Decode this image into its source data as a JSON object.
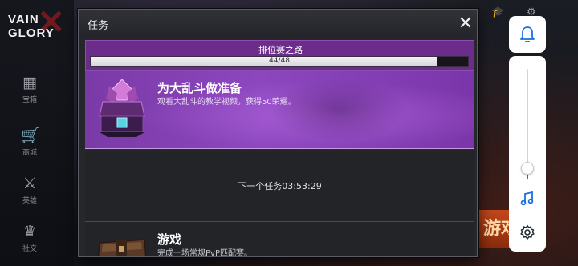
{
  "window": {
    "title": "任务",
    "close_glyph": "✕"
  },
  "background": {
    "logo_line1": "VAIN",
    "logo_line2": "GLORY",
    "rail_items": [
      {
        "icon": "treasure-icon",
        "glyph": "▦",
        "label": "宝箱"
      },
      {
        "icon": "shop-icon",
        "glyph": "🛒",
        "label": "商城"
      },
      {
        "icon": "heroes-icon",
        "glyph": "⚔",
        "label": "英雄"
      },
      {
        "icon": "guild-icon",
        "glyph": "♛",
        "label": "社交"
      }
    ],
    "play_button_label": "游戏"
  },
  "progress": {
    "label": "排位赛之路",
    "current": 44,
    "total": 48,
    "value_text": "44/48"
  },
  "quests": [
    {
      "title": "为大乱斗做准备",
      "description": "观看大乱斗的教学视频，获得50荣耀。",
      "icon": "crystal-chest-icon"
    },
    {
      "title": "游戏",
      "description": "完成一场常规PvP匹配赛。",
      "icon": "wooden-crate-icon"
    }
  ],
  "timer": {
    "text": "下一个任务03:53:29"
  },
  "side_panel": {
    "volume_level": 0.1,
    "icons": [
      "bell-icon",
      "music-note-icon",
      "settings-gear-icon"
    ]
  },
  "colors": {
    "accent_purple": "#7a3aa6",
    "progress_purple": "#6c2c8a",
    "panel_blue": "#1c6fe0"
  }
}
